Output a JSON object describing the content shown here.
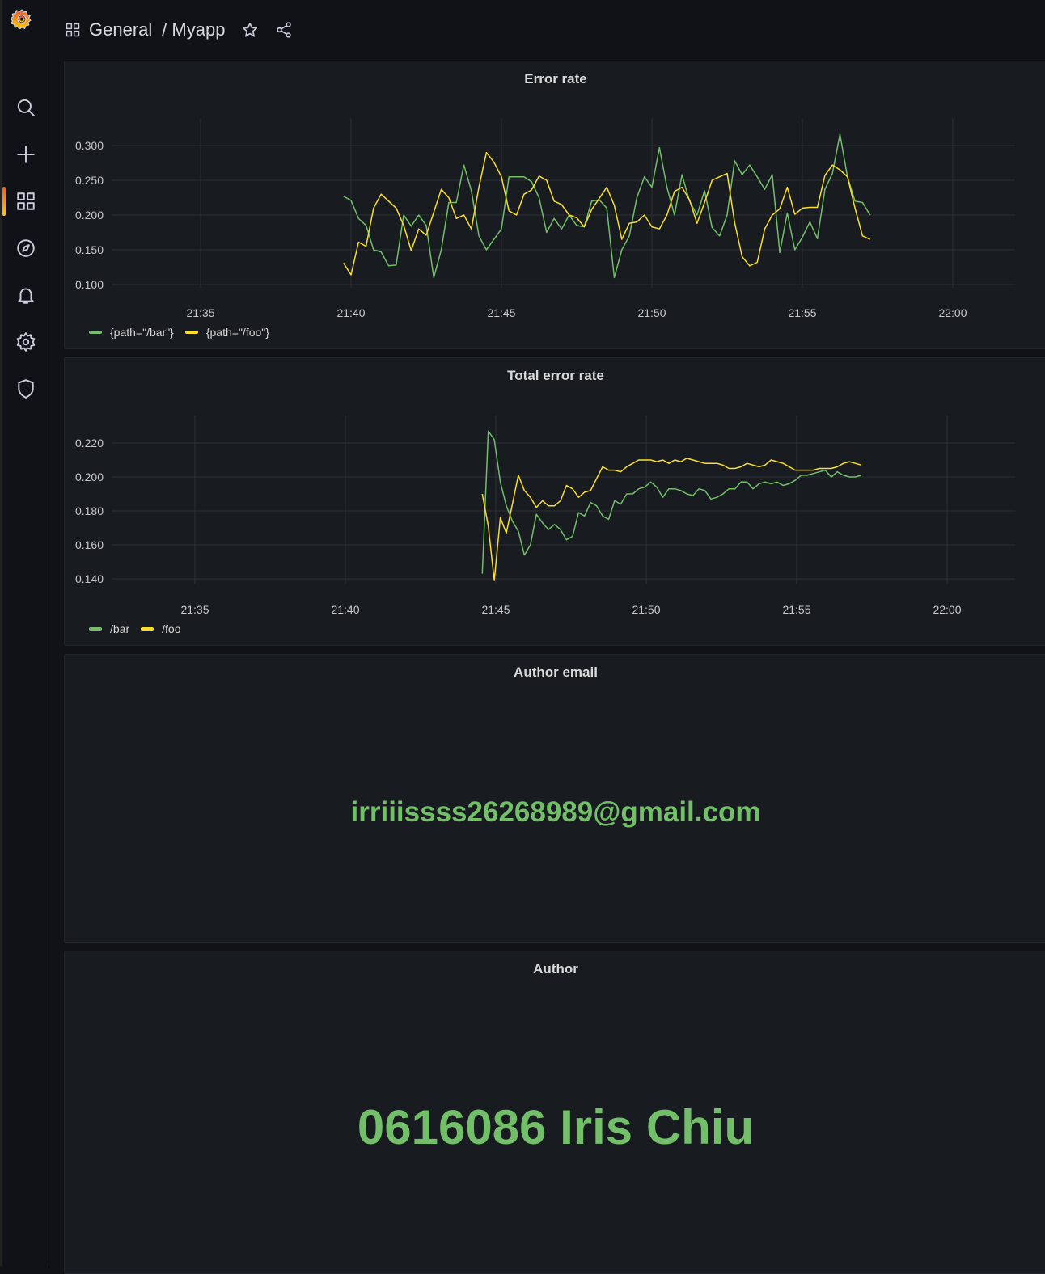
{
  "breadcrumb": {
    "folder": "General",
    "separator": "/",
    "dashboard": "Myapp"
  },
  "sidebar": {
    "items": [
      "search-icon",
      "plus-icon",
      "dashboards-icon",
      "explore-icon",
      "alerting-icon",
      "configuration-icon",
      "shield-icon"
    ],
    "active": "dashboards-icon"
  },
  "colors": {
    "green": "#73bf69",
    "yellow": "#fade2a",
    "background": "#111217",
    "panel": "#181b1f"
  },
  "panels": [
    {
      "title": "Error rate",
      "chart_data": {
        "type": "line",
        "title": "Error rate",
        "x_ticks": [
          "21:35",
          "21:40",
          "21:45",
          "21:50",
          "21:55",
          "22:00"
        ],
        "y_ticks": [
          "0.100",
          "0.150",
          "0.200",
          "0.250",
          "0.300"
        ],
        "xlim": [
          -10,
          12.5
        ],
        "ylim": [
          0.1,
          0.3
        ],
        "grid": true,
        "legend_position": "bottom-left",
        "series": [
          {
            "name": "{path=\"/bar\"}",
            "color": "#73bf69",
            "x": [
              -5.25,
              -5,
              -4.75,
              -4.5,
              -4.25,
              -4,
              -3.75,
              -3.5,
              -3.25,
              -3,
              -2.75,
              -2.5,
              -2.25,
              -2,
              -1.75,
              -1.5,
              -1.25,
              -1,
              -0.75,
              -0.5,
              -0.25,
              0,
              0.25,
              0.5,
              0.75,
              1,
              1.25,
              1.5,
              1.75,
              2,
              2.25,
              2.5,
              2.75,
              3,
              3.25,
              3.5,
              3.75,
              4,
              4.25,
              4.5,
              4.75,
              5,
              5.25,
              5.5,
              5.75,
              6,
              6.25,
              6.5,
              6.75,
              7,
              7.25,
              7.5,
              7.75,
              8,
              8.25,
              8.5,
              8.75,
              9,
              9.25,
              9.5,
              9.75,
              10,
              10.25,
              10.5,
              10.75,
              11,
              11.25,
              11.5,
              11.75,
              12,
              12.25
            ],
            "y": [
              0.227,
              0.221,
              0.195,
              0.185,
              0.15,
              0.147,
              0.127,
              0.128,
              0.2,
              0.184,
              0.2,
              0.185,
              0.11,
              0.15,
              0.218,
              0.218,
              0.272,
              0.235,
              0.17,
              0.15,
              0.165,
              0.18,
              0.255,
              0.255,
              0.255,
              0.248,
              0.225,
              0.175,
              0.195,
              0.18,
              0.2,
              0.185,
              0.183,
              0.22,
              0.222,
              0.21,
              0.11,
              0.15,
              0.17,
              0.225,
              0.255,
              0.24,
              0.297,
              0.24,
              0.2,
              0.258,
              0.22,
              0.2,
              0.235,
              0.182,
              0.17,
              0.2,
              0.278,
              0.258,
              0.272,
              0.255,
              0.237,
              0.258,
              0.146,
              0.203,
              0.15,
              0.168,
              0.19,
              0.166,
              0.237,
              0.26,
              0.316,
              0.255,
              0.22,
              0.218,
              0.2
            ]
          },
          {
            "name": "{path=\"/foo\"}",
            "color": "#fade2a",
            "x": [
              -5.25,
              -5,
              -4.75,
              -4.5,
              -4.25,
              -4,
              -3.75,
              -3.5,
              -3.25,
              -3,
              -2.75,
              -2.5,
              -2.25,
              -2,
              -1.75,
              -1.5,
              -1.25,
              -1,
              -0.75,
              -0.5,
              -0.25,
              0,
              0.25,
              0.5,
              0.75,
              1,
              1.25,
              1.5,
              1.75,
              2,
              2.25,
              2.5,
              2.75,
              3,
              3.25,
              3.5,
              3.75,
              4,
              4.25,
              4.5,
              4.75,
              5,
              5.25,
              5.5,
              5.75,
              6,
              6.25,
              6.5,
              6.75,
              7,
              7.25,
              7.5,
              7.75,
              8,
              8.25,
              8.5,
              8.75,
              9,
              9.25,
              9.5,
              9.75,
              10,
              10.25,
              10.5,
              10.75,
              11,
              11.25,
              11.5,
              11.75,
              12,
              12.25
            ],
            "y": [
              0.131,
              0.114,
              0.161,
              0.155,
              0.21,
              0.23,
              0.22,
              0.21,
              0.185,
              0.149,
              0.18,
              0.171,
              0.204,
              0.237,
              0.225,
              0.195,
              0.2,
              0.18,
              0.24,
              0.29,
              0.276,
              0.255,
              0.206,
              0.2,
              0.23,
              0.236,
              0.256,
              0.25,
              0.22,
              0.215,
              0.2,
              0.196,
              0.183,
              0.208,
              0.224,
              0.24,
              0.214,
              0.165,
              0.188,
              0.19,
              0.2,
              0.183,
              0.18,
              0.2,
              0.234,
              0.24,
              0.222,
              0.188,
              0.218,
              0.25,
              0.255,
              0.26,
              0.189,
              0.14,
              0.127,
              0.132,
              0.18,
              0.2,
              0.209,
              0.24,
              0.201,
              0.21,
              0.211,
              0.211,
              0.257,
              0.272,
              0.265,
              0.255,
              0.21,
              0.17,
              0.165
            ]
          }
        ]
      }
    },
    {
      "title": "Total error rate",
      "chart_data": {
        "type": "line",
        "title": "Total error rate",
        "x_ticks": [
          "21:35",
          "21:40",
          "21:45",
          "21:50",
          "21:55",
          "22:00"
        ],
        "y_ticks": [
          "0.140",
          "0.160",
          "0.180",
          "0.200",
          "0.220"
        ],
        "xlim": [
          -10,
          12.25
        ],
        "ylim": [
          0.14,
          0.22
        ],
        "grid": true,
        "legend_position": "bottom-left",
        "series": [
          {
            "name": "/bar",
            "color": "#73bf69",
            "x": [
              -0.45,
              -0.25,
              -0.05,
              0.15,
              0.35,
              0.55,
              0.75,
              0.95,
              1.15,
              1.35,
              1.55,
              1.75,
              1.95,
              2.15,
              2.35,
              2.55,
              2.75,
              2.95,
              3.15,
              3.35,
              3.55,
              3.75,
              3.95,
              4.15,
              4.35,
              4.55,
              4.75,
              4.95,
              5.15,
              5.35,
              5.55,
              5.75,
              5.95,
              6.15,
              6.35,
              6.55,
              6.75,
              6.95,
              7.15,
              7.35,
              7.55,
              7.75,
              7.95,
              8.15,
              8.35,
              8.55,
              8.75,
              8.95,
              9.15,
              9.35,
              9.55,
              9.75,
              9.95,
              10.15,
              10.35,
              10.55,
              10.75,
              10.95,
              11.15,
              11.35,
              11.55,
              11.75,
              11.95,
              12.15
            ],
            "y": [
              0.143,
              0.227,
              0.222,
              0.197,
              0.183,
              0.174,
              0.168,
              0.154,
              0.16,
              0.178,
              0.173,
              0.169,
              0.172,
              0.169,
              0.163,
              0.165,
              0.179,
              0.177,
              0.185,
              0.183,
              0.177,
              0.175,
              0.186,
              0.184,
              0.19,
              0.19,
              0.193,
              0.194,
              0.197,
              0.194,
              0.188,
              0.193,
              0.193,
              0.192,
              0.19,
              0.189,
              0.193,
              0.192,
              0.187,
              0.188,
              0.19,
              0.193,
              0.193,
              0.197,
              0.197,
              0.193,
              0.196,
              0.197,
              0.196,
              0.197,
              0.195,
              0.196,
              0.198,
              0.201,
              0.201,
              0.202,
              0.203,
              0.204,
              0.2,
              0.203,
              0.201,
              0.2,
              0.2,
              0.201
            ]
          },
          {
            "name": "/foo",
            "color": "#fade2a",
            "x": [
              -0.45,
              -0.25,
              -0.05,
              0.15,
              0.35,
              0.55,
              0.75,
              0.95,
              1.15,
              1.35,
              1.55,
              1.75,
              1.95,
              2.15,
              2.35,
              2.55,
              2.75,
              2.95,
              3.15,
              3.35,
              3.55,
              3.75,
              3.95,
              4.15,
              4.35,
              4.55,
              4.75,
              4.95,
              5.15,
              5.35,
              5.55,
              5.75,
              5.95,
              6.15,
              6.35,
              6.55,
              6.75,
              6.95,
              7.15,
              7.35,
              7.55,
              7.75,
              7.95,
              8.15,
              8.35,
              8.55,
              8.75,
              8.95,
              9.15,
              9.35,
              9.55,
              9.75,
              9.95,
              10.15,
              10.35,
              10.55,
              10.75,
              10.95,
              11.15,
              11.35,
              11.55,
              11.75,
              11.95,
              12.15
            ],
            "y": [
              0.19,
              0.171,
              0.139,
              0.176,
              0.167,
              0.184,
              0.201,
              0.192,
              0.188,
              0.182,
              0.186,
              0.183,
              0.183,
              0.186,
              0.195,
              0.193,
              0.188,
              0.191,
              0.192,
              0.199,
              0.206,
              0.204,
              0.204,
              0.203,
              0.206,
              0.208,
              0.21,
              0.21,
              0.21,
              0.209,
              0.21,
              0.208,
              0.21,
              0.209,
              0.211,
              0.21,
              0.209,
              0.208,
              0.208,
              0.208,
              0.207,
              0.205,
              0.205,
              0.206,
              0.208,
              0.207,
              0.206,
              0.207,
              0.21,
              0.209,
              0.208,
              0.206,
              0.204,
              0.204,
              0.204,
              0.204,
              0.205,
              0.205,
              0.205,
              0.206,
              0.208,
              0.209,
              0.208,
              0.207
            ]
          }
        ]
      }
    },
    {
      "title": "Author email",
      "value": "irriiissss26268989@gmail.com"
    },
    {
      "title": "Author",
      "value": "0616086 Iris Chiu"
    }
  ]
}
